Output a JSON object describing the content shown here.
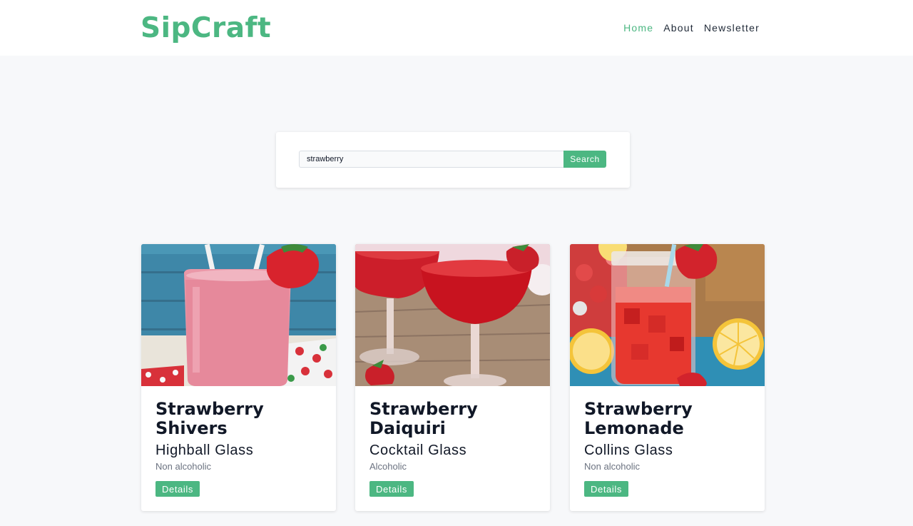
{
  "brand": {
    "name": "SipCraft",
    "color": "#4cb782"
  },
  "nav": {
    "items": [
      "Home",
      "About",
      "Newsletter"
    ],
    "active": "Home"
  },
  "search": {
    "value": "strawberry",
    "button_label": "Search"
  },
  "results": [
    {
      "title": "Strawberry Shivers",
      "glass": "Highball Glass",
      "type": "Non alcoholic",
      "details_label": "Details",
      "image": "strawberry-smoothie-photo"
    },
    {
      "title": "Strawberry Daiquiri",
      "glass": "Cocktail Glass",
      "type": "Alcoholic",
      "details_label": "Details",
      "image": "strawberry-daiquiri-photo"
    },
    {
      "title": "Strawberry Lemonade",
      "glass": "Collins Glass",
      "type": "Non alcoholic",
      "details_label": "Details",
      "image": "strawberry-lemonade-photo"
    }
  ]
}
